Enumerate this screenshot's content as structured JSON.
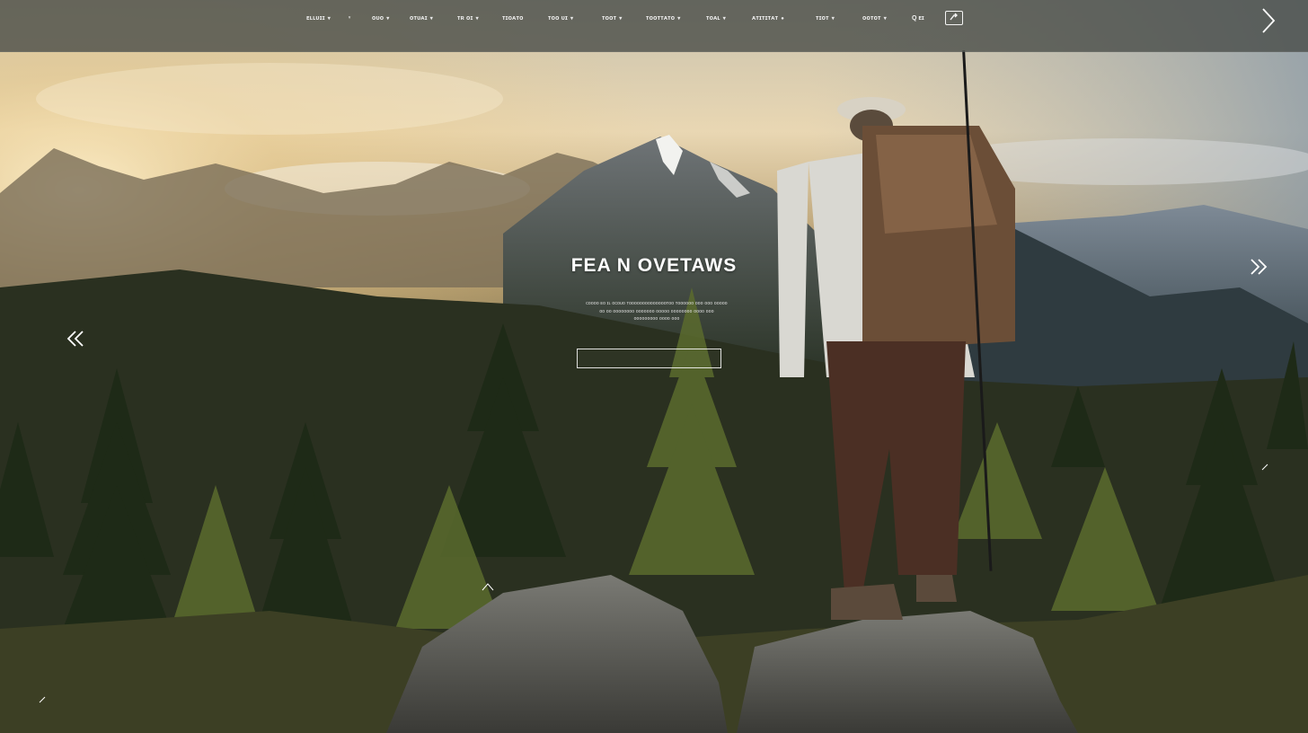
{
  "nav": {
    "items": [
      {
        "label": "ᴇʟʟᴜɪɪ",
        "caret": "▾"
      },
      {
        "label": "ᴏᴜᴏ",
        "caret": "▾"
      },
      {
        "label": "ᴏᴛᴜᴀɪ",
        "caret": "▾"
      },
      {
        "label": "ᴛʀ ᴏɪ",
        "caret": "▾"
      },
      {
        "label": "ᴛɪᴏᴀᴛᴏ",
        "caret": ""
      },
      {
        "label": "ᴛᴏᴏ ᴜɪ",
        "caret": "▾"
      },
      {
        "label": "ᴛᴏᴏᴛ",
        "caret": "▾"
      },
      {
        "label": "ᴛᴏᴏᴛᴛᴀᴛᴏ",
        "caret": "▾"
      },
      {
        "label": "ᴛᴏᴀʟ",
        "caret": "▾"
      },
      {
        "label": "ᴀᴛɪᴛɪᴛᴀᴛ",
        "caret": "●"
      },
      {
        "label": "ᴛɪᴏᴛ",
        "caret": "▾"
      },
      {
        "label": "ᴏᴏᴛᴏᴛ",
        "caret": "▾"
      }
    ],
    "extra_caret": "ᵛ",
    "search_label": "Q ᴇɪ",
    "search_icon": "search-icon",
    "box_icon": "share-icon"
  },
  "hero": {
    "title": "FEA N OVETAWS",
    "subtitle_lines": [
      "ᴄᴏᴏᴏᴏ ᴇᴏ ɪʟ ᴏᴄᴏᴜᴏ ᴛᴏᴏᴏᴏᴏᴏᴏᴏᴏᴏᴏᴏᴏᴏᴛᴏᴏ ᴛᴏᴏᴏᴏᴏᴏ ᴏᴏᴏ ᴏᴏᴏ ᴏᴏᴏᴏᴏ",
      "ᴏᴏ ᴏᴏ ᴏᴏᴏᴏᴏᴏᴏᴏ ᴏᴏᴏᴏᴏᴏᴏ ᴏᴏᴏᴏᴏ ᴏᴏᴏᴏᴏᴏᴏᴏ ᴏᴏᴏᴏ ᴏᴏᴏ",
      "ᴏᴏᴏᴏᴏᴏᴏᴏᴏ ᴏᴏᴏᴏ ᴏᴏᴏ"
    ],
    "cta_label": ""
  },
  "controls": {
    "prev_icon": "double-chevron-left-icon",
    "next_icon": "double-chevron-right-icon",
    "next_top_icon": "chevron-right-icon"
  },
  "colors": {
    "topbar": "#464a46",
    "text": "#ffffff",
    "sky_warm": "#f2d9a8",
    "forest_dark": "#1f2a1a",
    "mountain_blue": "#5c6f80"
  }
}
